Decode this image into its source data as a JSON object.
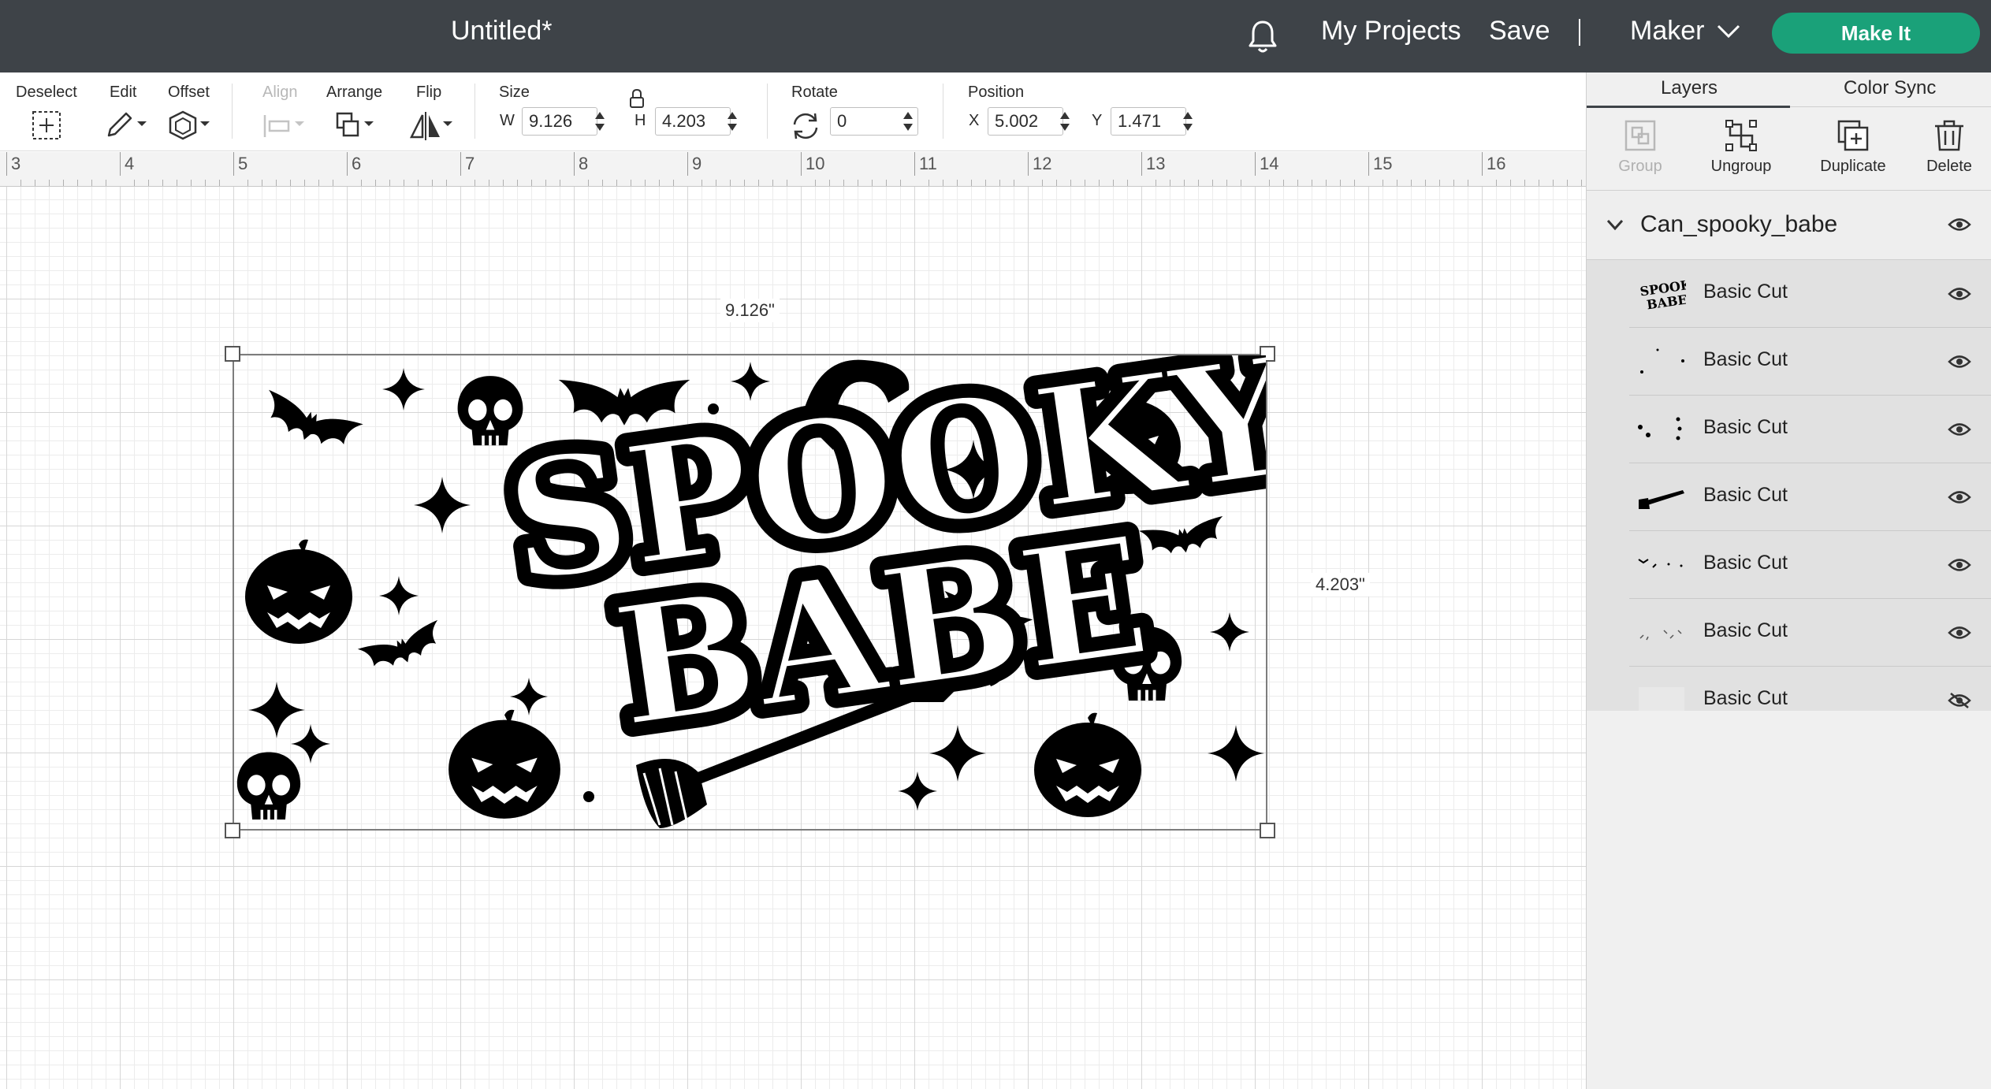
{
  "header": {
    "document_title": "Untitled*",
    "my_projects": "My Projects",
    "save": "Save",
    "separator": "|",
    "machine": "Maker",
    "make_it": "Make It"
  },
  "toolbar": {
    "deselect": "Deselect",
    "edit": "Edit",
    "offset": "Offset",
    "align": "Align",
    "arrange": "Arrange",
    "flip": "Flip",
    "size": "Size",
    "w_prefix": "W",
    "w_value": "9.126",
    "h_prefix": "H",
    "h_value": "4.203",
    "rotate": "Rotate",
    "rotate_value": "0",
    "position": "Position",
    "x_prefix": "X",
    "x_value": "5.002",
    "y_prefix": "Y",
    "y_value": "1.471"
  },
  "ruler": {
    "labels": [
      "3",
      "4",
      "5",
      "6",
      "7",
      "8",
      "9",
      "10",
      "11",
      "12",
      "13",
      "14",
      "15",
      "16"
    ]
  },
  "canvas": {
    "width_label": "9.126\"",
    "height_label": "4.203\"",
    "design_text_line1": "SPOOKY",
    "design_text_line2": "BABE"
  },
  "panel": {
    "tabs": [
      "Layers",
      "Color Sync"
    ],
    "actions": {
      "group": "Group",
      "ungroup": "Ungroup",
      "duplicate": "Duplicate",
      "delete": "Delete"
    },
    "group_name": "Can_spooky_babe",
    "layers": [
      {
        "name": "Basic Cut",
        "visible": true
      },
      {
        "name": "Basic Cut",
        "visible": true
      },
      {
        "name": "Basic Cut",
        "visible": true
      },
      {
        "name": "Basic Cut",
        "visible": true
      },
      {
        "name": "Basic Cut",
        "visible": true
      },
      {
        "name": "Basic Cut",
        "visible": true
      },
      {
        "name": "Basic Cut",
        "visible": false
      }
    ]
  },
  "colors": {
    "header_bg": "#3e4348",
    "make_it": "#1aa179",
    "panel_bg": "#f0f0f0"
  }
}
